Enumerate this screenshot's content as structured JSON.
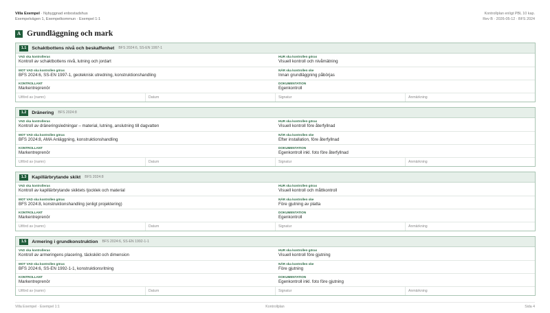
{
  "header": {
    "project": "Villa Exempel",
    "subtitle": "· Nybyggnad enbostadshus",
    "address": "Exempelvägen 1, Exempelkommun · Exempel 1:1",
    "doc_type": "Kontrollplan enligt PBL 10 kap.",
    "revision": "Rev B · 2026-05-12 · BFS 2024"
  },
  "section": {
    "badge": "A",
    "title": "Grundläggning och mark"
  },
  "labels": {
    "what": "VAD ska kontrolleras",
    "how": "HUR ska kontrollen göras",
    "against": "MOT VAD ska kontrollen göras",
    "when": "NÄR ska kontrollen ske",
    "controller": "KONTROLLANT",
    "documentation": "DOKUMENTATION",
    "performed_by": "Utförd av (namn)",
    "date": "Datum",
    "signature": "Signatur",
    "remark": "Anmärkning"
  },
  "cards": [
    {
      "num": "1.1",
      "title": "Schaktbottens nivå och beskaffenhet",
      "ref": "BFS 2024:6, SS-EN 1997-1",
      "what": "Kontroll av schaktbottens nivå, lutning och jordart",
      "how": "Visuell kontroll och nivåmätning",
      "against": "BFS 2024:6, SS-EN 1997-1, geoteknisk utredning, konstruktionshandling",
      "when": "Innan grundläggning påbörjas",
      "controller": "Markentreprenör",
      "documentation": "Egenkontroll"
    },
    {
      "num": "1.2",
      "title": "Dränering",
      "ref": "BFS 2024:8",
      "what": "Kontroll av dräneringsledningar – material, lutning, anslutning till dagvatten",
      "how": "Visuell kontroll före återfyllnad",
      "against": "BFS 2024:8, AMA Anläggning, konstruktionshandling",
      "when": "Efter installation, före återfyllnad",
      "controller": "Markentreprenör",
      "documentation": "Egenkontroll inkl. foto före återfyllnad"
    },
    {
      "num": "1.3",
      "title": "Kapillärbrytande skikt",
      "ref": "BFS 2024:8",
      "what": "Kontroll av kapillärbrytande skiktets tjocklek och material",
      "how": "Visuell kontroll och måttkontroll",
      "against": "BFS 2024:8, konstruktionshandling (enligt projektering)",
      "when": "Före gjutning av platta",
      "controller": "Markentreprenör",
      "documentation": "Egenkontroll"
    },
    {
      "num": "1.5",
      "title": "Armering i grundkonstruktion",
      "ref": "BFS 2024:6, SS-EN 1992-1-1",
      "what": "Kontroll av armeringens placering, täckskikt och dimension",
      "how": "Visuell kontroll före gjutning",
      "against": "BFS 2024:6, SS-EN 1992-1-1, konstruktionsritning",
      "when": "Före gjutning",
      "controller": "Markentreprenör",
      "documentation": "Egenkontroll inkl. foto före gjutning"
    }
  ],
  "footer": {
    "left": "Villa Exempel · Exempel 1:1",
    "center": "Kontrollplan",
    "right": "Sida 4"
  }
}
